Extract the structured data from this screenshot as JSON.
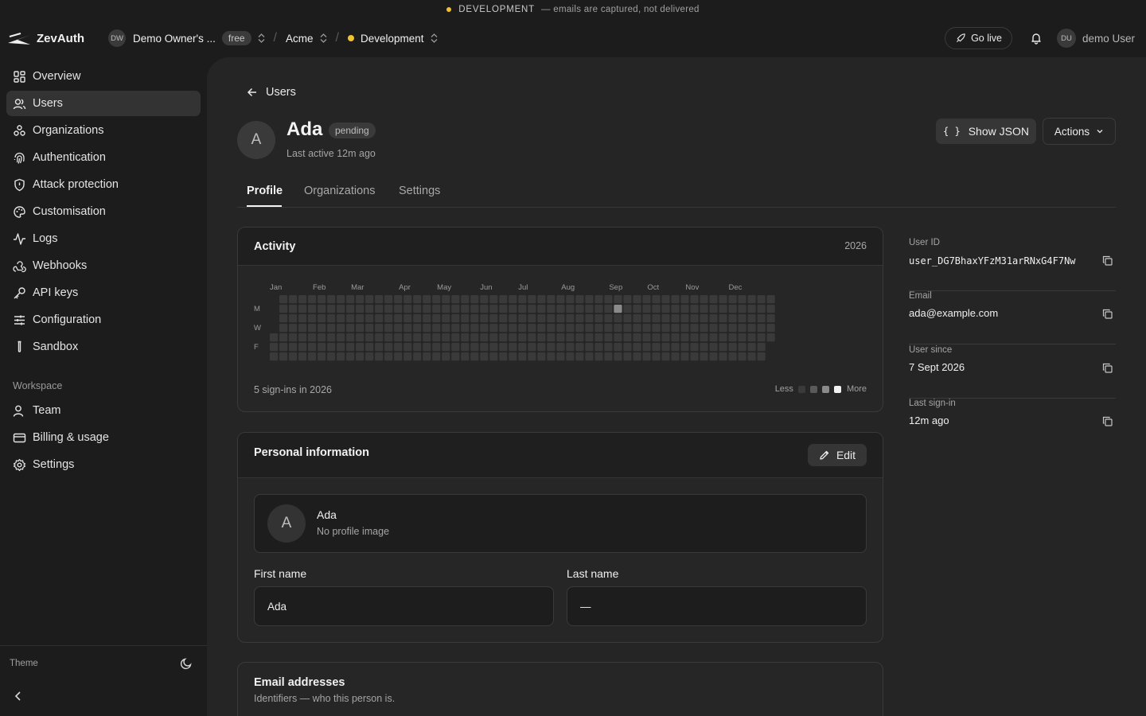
{
  "banner": {
    "env": "DEVELOPMENT",
    "message": "— emails are captured, not delivered"
  },
  "topbar": {
    "brand": "ZevAuth",
    "org_initials": "DW",
    "org_name": "Demo Owner's ...",
    "plan": "free",
    "app": "Acme",
    "environment": "Development",
    "go_live": "Go live",
    "user_initials": "DU",
    "user_name": "demo User"
  },
  "sidebar": {
    "items": [
      {
        "label": "Overview",
        "icon": "grid-icon"
      },
      {
        "label": "Users",
        "icon": "users-icon",
        "active": true
      },
      {
        "label": "Organizations",
        "icon": "organizations-icon"
      },
      {
        "label": "Authentication",
        "icon": "fingerprint-icon"
      },
      {
        "label": "Attack protection",
        "icon": "shield-icon"
      },
      {
        "label": "Customisation",
        "icon": "palette-icon"
      },
      {
        "label": "Logs",
        "icon": "activity-icon"
      },
      {
        "label": "Webhooks",
        "icon": "webhook-icon"
      },
      {
        "label": "API keys",
        "icon": "key-icon"
      },
      {
        "label": "Configuration",
        "icon": "sliders-icon"
      },
      {
        "label": "Sandbox",
        "icon": "test-tube-icon"
      }
    ],
    "workspace_label": "Workspace",
    "workspace_items": [
      {
        "label": "Team",
        "icon": "team-icon"
      },
      {
        "label": "Billing & usage",
        "icon": "credit-card-icon"
      },
      {
        "label": "Settings",
        "icon": "gear-icon"
      }
    ],
    "theme_label": "Theme"
  },
  "page": {
    "back_label": "Users",
    "avatar_initial": "A",
    "name": "Ada",
    "status": "pending",
    "last_active": "Last active 12m ago",
    "show_json": "Show JSON",
    "actions": "Actions",
    "tabs": [
      "Profile",
      "Organizations",
      "Settings"
    ]
  },
  "activity": {
    "title": "Activity",
    "year": "2026",
    "months": [
      "Jan",
      "Feb",
      "Mar",
      "Apr",
      "May",
      "Jun",
      "Jul",
      "Aug",
      "Sep",
      "Oct",
      "Nov",
      "Dec"
    ],
    "day_labels": [
      "M",
      "W",
      "F"
    ],
    "summary": "5 sign-ins in 2026",
    "legend_less": "Less",
    "legend_more": "More",
    "active_cells": [
      {
        "week": 36,
        "day": 1,
        "level": 2
      }
    ],
    "colors": {
      "level0": "#3a3a3a",
      "level1": "#5a5a5a",
      "level2": "#8a8a8a",
      "level3": "#f2f2f2"
    }
  },
  "personal": {
    "title": "Personal information",
    "edit": "Edit",
    "name": "Ada",
    "initial": "A",
    "no_image": "No profile image",
    "first_name_label": "First name",
    "first_name": "Ada",
    "last_name_label": "Last name",
    "last_name": "—"
  },
  "emails": {
    "title": "Email addresses",
    "description": "Identifiers — who this person is."
  },
  "meta": [
    {
      "label": "User ID",
      "value": "user_DG7BhaxYFzM31arRNxG4F7Nw"
    },
    {
      "label": "Email",
      "value": "ada@example.com"
    },
    {
      "label": "User since",
      "value": "7 Sept 2026"
    },
    {
      "label": "Last sign-in",
      "value": "12m ago"
    }
  ]
}
